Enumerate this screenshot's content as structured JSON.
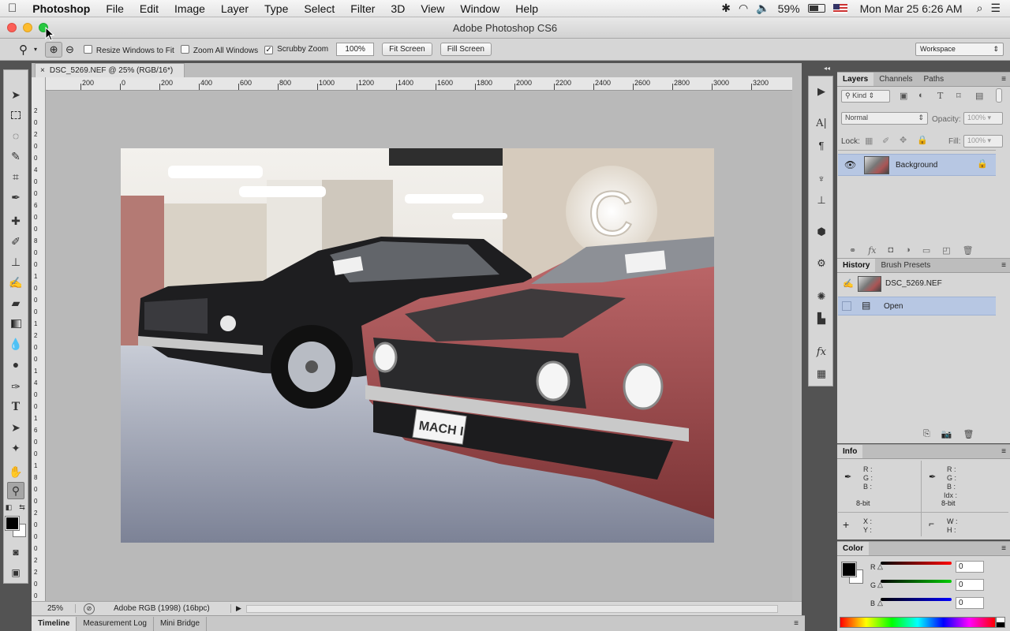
{
  "menubar": {
    "apple": "",
    "items": [
      "Photoshop",
      "File",
      "Edit",
      "Image",
      "Layer",
      "Type",
      "Select",
      "Filter",
      "3D",
      "View",
      "Window",
      "Help"
    ],
    "battery": "59%",
    "datetime": "Mon Mar 25  6:26 AM"
  },
  "window": {
    "title": "Adobe Photoshop CS6"
  },
  "options": {
    "resize_windows": "Resize Windows to Fit",
    "zoom_all": "Zoom All Windows",
    "scrubby": "Scrubby Zoom",
    "zoom_value": "100%",
    "fit_screen": "Fit Screen",
    "fill_screen": "Fill Screen",
    "workspace": "Workspace"
  },
  "document": {
    "tab_title": "DSC_5269.NEF @ 25% (RGB/16*)",
    "hruler_ticks": [
      "200",
      "0",
      "200",
      "400",
      "600",
      "800",
      "1000",
      "1200",
      "1400",
      "1600",
      "1800",
      "2000",
      "2200",
      "2400",
      "2600",
      "2800",
      "3000",
      "3200"
    ],
    "vruler_ticks": [
      "2",
      "0",
      "2",
      "0",
      "0",
      "4",
      "0",
      "0",
      "6",
      "0",
      "0",
      "8",
      "0",
      "0",
      "1",
      "0",
      "0",
      "0",
      "1",
      "2",
      "0",
      "0",
      "1",
      "4",
      "0",
      "0",
      "1",
      "6",
      "0",
      "0",
      "1",
      "8",
      "0",
      "0",
      "2",
      "0",
      "0",
      "0",
      "2",
      "2",
      "0",
      "0"
    ],
    "zoom": "25%",
    "profile": "Adobe RGB (1998) (16bpc)",
    "plate": "MACH I"
  },
  "bottom_tabs": [
    "Timeline",
    "Measurement Log",
    "Mini Bridge"
  ],
  "layers_panel": {
    "tabs": [
      "Layers",
      "Channels",
      "Paths"
    ],
    "kind": "Kind",
    "blend": "Normal",
    "opacity_label": "Opacity:",
    "opacity": "100%",
    "lock_label": "Lock:",
    "fill_label": "Fill:",
    "fill": "100%",
    "layer_name": "Background"
  },
  "history_panel": {
    "tabs": [
      "History",
      "Brush Presets"
    ],
    "snapshot": "DSC_5269.NEF",
    "step": "Open"
  },
  "info_panel": {
    "title": "Info",
    "r": "R :",
    "g": "G :",
    "b": "B :",
    "idx": "Idx :",
    "bit1": "8-bit",
    "bit2": "8-bit",
    "x": "X :",
    "y": "Y :",
    "w": "W :",
    "h": "H :"
  },
  "color_panel": {
    "title": "Color",
    "r_label": "R",
    "g_label": "G",
    "b_label": "B",
    "r": "0",
    "g": "0",
    "b": "0"
  },
  "colors": {
    "accent": "#b7c7e3",
    "panel": "#d6d6d6",
    "chrome": "#535353"
  }
}
